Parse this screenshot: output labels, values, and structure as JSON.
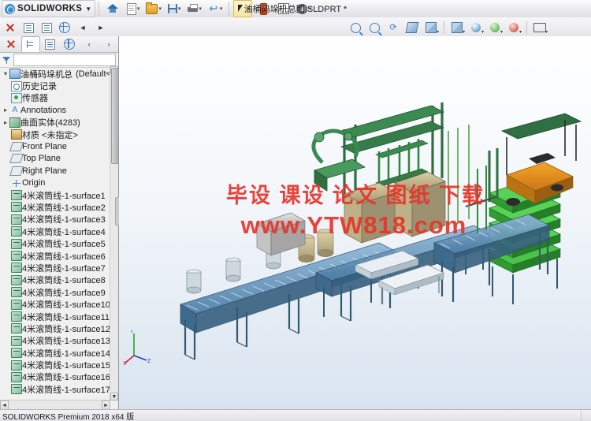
{
  "window": {
    "app_name": "SOLIDWORKS",
    "document_title": "油桶码垛机总图.SLDPRT *"
  },
  "toolbar": {
    "logo_caret": "▼",
    "buttons": [
      {
        "name": "home",
        "icon": "home-icon",
        "label": ""
      },
      {
        "name": "new",
        "icon": "new-document-icon",
        "label": "",
        "dropdown": "▾"
      },
      {
        "name": "open",
        "icon": "open-folder-icon",
        "label": "",
        "dropdown": "▾"
      },
      {
        "name": "save",
        "icon": "save-icon",
        "label": "",
        "dropdown": "▾"
      },
      {
        "name": "print",
        "icon": "print-icon",
        "label": "",
        "dropdown": "▾"
      },
      {
        "name": "undo",
        "icon": "undo-icon",
        "label": "↩",
        "dropdown": "▾"
      },
      {
        "name": "select",
        "icon": "select-arrow-icon",
        "label": "",
        "dropdown": "▾"
      },
      {
        "name": "rebuild",
        "icon": "rebuild-icon",
        "label": ""
      },
      {
        "name": "options-grid",
        "icon": "grid-icon",
        "label": ""
      },
      {
        "name": "settings",
        "icon": "gear-icon",
        "label": "",
        "dropdown": "▾"
      }
    ]
  },
  "viewbar": {
    "left_buttons": [
      {
        "name": "zoom-to-fit",
        "icon": "magnifier-icon"
      },
      {
        "name": "tree-display",
        "icon": "tree-icon"
      },
      {
        "name": "property-manager",
        "icon": "property-icon"
      },
      {
        "name": "configuration-manager",
        "icon": "globe-icon"
      },
      {
        "name": "panel-collapse",
        "icon": "chevron-left-icon"
      },
      {
        "name": "panel-expand",
        "icon": "chevron-right-icon"
      }
    ],
    "right_buttons": [
      {
        "name": "zoom-to-area",
        "icon": "magnifier-icon"
      },
      {
        "name": "zoom-in-out",
        "icon": "magnifier-plus-icon"
      },
      {
        "name": "rotate-view",
        "icon": "rotate-icon"
      },
      {
        "name": "section-view",
        "icon": "section-view-icon"
      },
      {
        "name": "view-orientation",
        "icon": "view-orientation-icon"
      },
      {
        "name": "display-style",
        "icon": "display-style-icon"
      },
      {
        "name": "hide-show-items",
        "icon": "eye-icon"
      },
      {
        "name": "edit-appearance",
        "icon": "appearance-sphere-icon"
      },
      {
        "name": "apply-scene",
        "icon": "scene-icon"
      },
      {
        "name": "view-settings",
        "icon": "view-settings-icon"
      },
      {
        "name": "full-screen",
        "icon": "screen-icon"
      }
    ]
  },
  "feature_tree": {
    "tabs": [
      {
        "name": "feature-manager-tab",
        "icon": "tree-icon",
        "active": true
      },
      {
        "name": "property-manager-tab",
        "icon": "property-icon",
        "active": false
      },
      {
        "name": "configuration-manager-tab",
        "icon": "globe-icon",
        "active": false
      },
      {
        "name": "display-manager-tab",
        "icon": "display-icon",
        "active": false
      },
      {
        "name": "scroll-left",
        "icon": "chevron-left-icon",
        "active": false
      },
      {
        "name": "scroll-right",
        "icon": "chevron-right-icon",
        "active": false
      }
    ],
    "root": {
      "label": "油桶码垛机总图",
      "suffix": "(Default<<",
      "icon": "part-icon"
    },
    "items": [
      {
        "label": "历史记录",
        "icon": "history-icon",
        "indent": 1,
        "expander": ""
      },
      {
        "label": "传感器",
        "icon": "sensor-icon",
        "indent": 1,
        "expander": ""
      },
      {
        "label": "Annotations",
        "icon": "annotations-icon",
        "indent": 1,
        "expander": "▸"
      },
      {
        "label": "曲面实体(4283)",
        "icon": "surface-bodies-icon",
        "indent": 1,
        "expander": "▸"
      },
      {
        "label": "材质 <未指定>",
        "icon": "material-icon",
        "indent": 1,
        "expander": ""
      },
      {
        "label": "Front Plane",
        "icon": "plane-icon",
        "indent": 1,
        "expander": ""
      },
      {
        "label": "Top Plane",
        "icon": "plane-icon",
        "indent": 1,
        "expander": ""
      },
      {
        "label": "Right Plane",
        "icon": "plane-icon",
        "indent": 1,
        "expander": ""
      },
      {
        "label": "Origin",
        "icon": "origin-icon",
        "indent": 1,
        "expander": ""
      },
      {
        "label": "4米滚筒线-1-surface1",
        "icon": "surface-body-icon",
        "indent": 1,
        "expander": ""
      },
      {
        "label": "4米滚筒线-1-surface2",
        "icon": "surface-body-icon",
        "indent": 1,
        "expander": ""
      },
      {
        "label": "4米滚筒线-1-surface3",
        "icon": "surface-body-icon",
        "indent": 1,
        "expander": ""
      },
      {
        "label": "4米滚筒线-1-surface4",
        "icon": "surface-body-icon",
        "indent": 1,
        "expander": ""
      },
      {
        "label": "4米滚筒线-1-surface5",
        "icon": "surface-body-icon",
        "indent": 1,
        "expander": ""
      },
      {
        "label": "4米滚筒线-1-surface6",
        "icon": "surface-body-icon",
        "indent": 1,
        "expander": ""
      },
      {
        "label": "4米滚筒线-1-surface7",
        "icon": "surface-body-icon",
        "indent": 1,
        "expander": ""
      },
      {
        "label": "4米滚筒线-1-surface8",
        "icon": "surface-body-icon",
        "indent": 1,
        "expander": ""
      },
      {
        "label": "4米滚筒线-1-surface9",
        "icon": "surface-body-icon",
        "indent": 1,
        "expander": ""
      },
      {
        "label": "4米滚筒线-1-surface10",
        "icon": "surface-body-icon",
        "indent": 1,
        "expander": ""
      },
      {
        "label": "4米滚筒线-1-surface11",
        "icon": "surface-body-icon",
        "indent": 1,
        "expander": ""
      },
      {
        "label": "4米滚筒线-1-surface12",
        "icon": "surface-body-icon",
        "indent": 1,
        "expander": ""
      },
      {
        "label": "4米滚筒线-1-surface13",
        "icon": "surface-body-icon",
        "indent": 1,
        "expander": ""
      },
      {
        "label": "4米滚筒线-1-surface14",
        "icon": "surface-body-icon",
        "indent": 1,
        "expander": ""
      },
      {
        "label": "4米滚筒线-1-surface15",
        "icon": "surface-body-icon",
        "indent": 1,
        "expander": ""
      },
      {
        "label": "4米滚筒线-1-surface16",
        "icon": "surface-body-icon",
        "indent": 1,
        "expander": ""
      },
      {
        "label": "4米滚筒线-1-surface17",
        "icon": "surface-body-icon",
        "indent": 1,
        "expander": ""
      }
    ],
    "scroll": {
      "up": "▲",
      "down": "▼",
      "left": "◄",
      "right": "►"
    }
  },
  "graphics": {
    "watermark_line1": "毕设  课设  论文  图纸  下载",
    "watermark_line2": "www.YTW818.com",
    "watermark_color": "#e8342a",
    "triad_labels": {
      "x": "X",
      "y": "Y",
      "z": "Z"
    },
    "background_top": "#ffffff",
    "background_bottom": "#d9e4ef"
  },
  "statusbar": {
    "text": "SOLIDWORKS Premium 2018 x64 版"
  }
}
